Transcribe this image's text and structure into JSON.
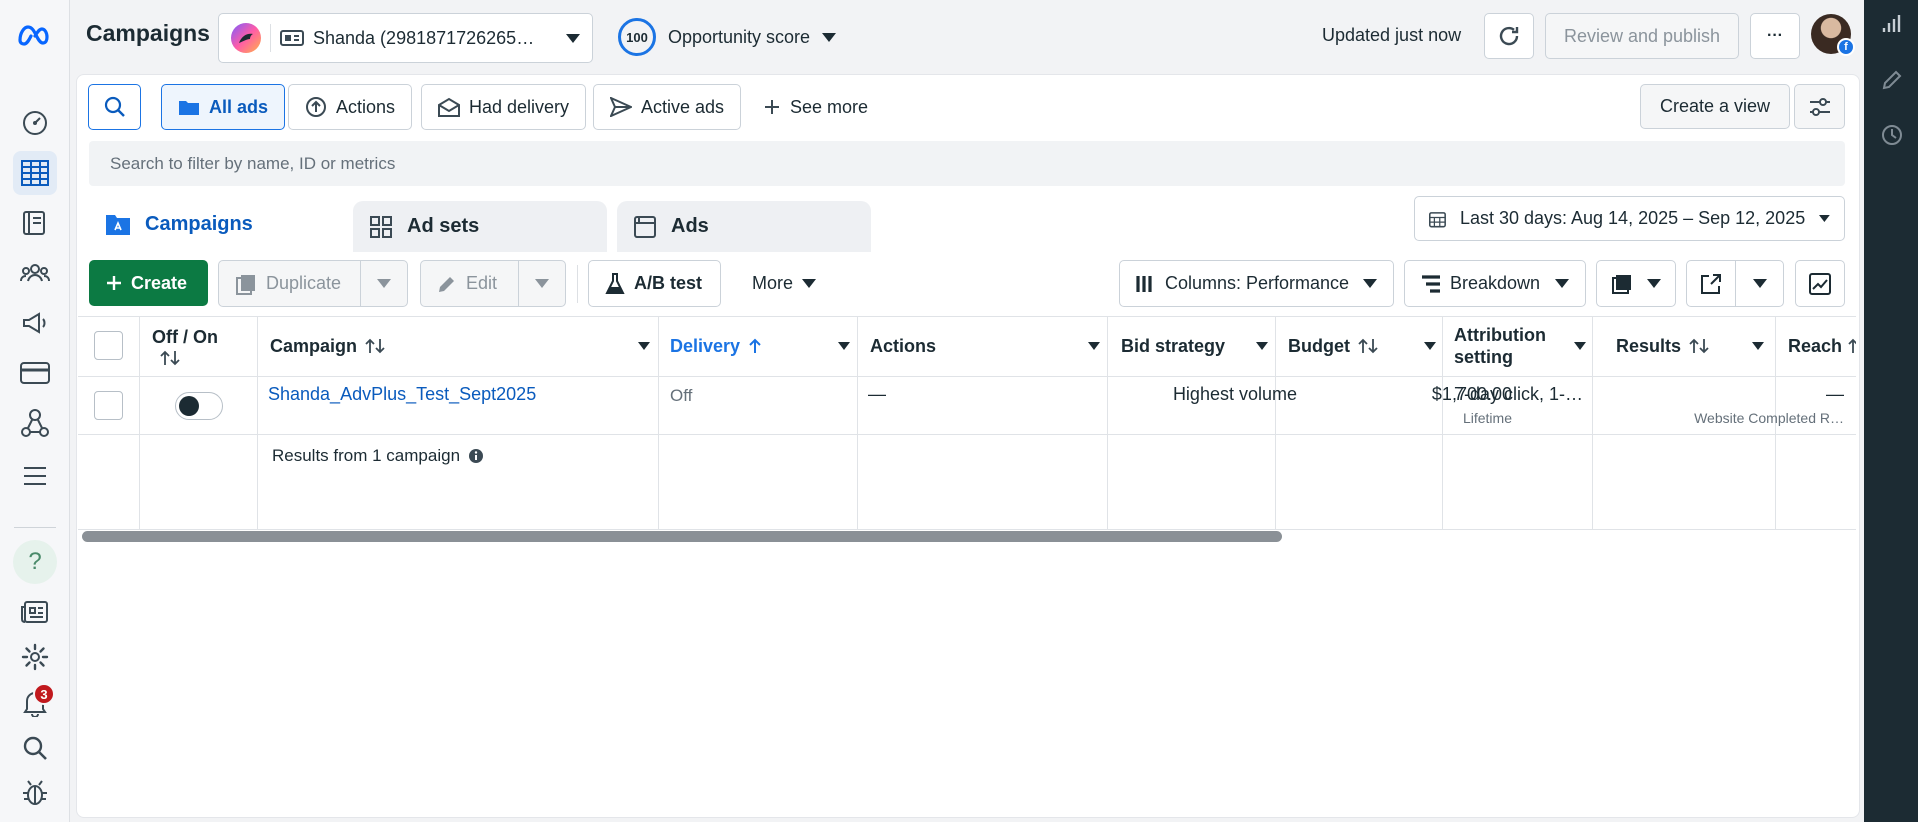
{
  "header": {
    "title": "Campaigns",
    "account_name": "Shanda (2981871726265…",
    "opportunity_score": "100",
    "opportunity_label": "Opportunity score",
    "updated": "Updated just now",
    "review_publish": "Review and publish",
    "more": "···"
  },
  "filters": {
    "all_ads": "All ads",
    "actions": "Actions",
    "had_delivery": "Had delivery",
    "active_ads": "Active ads",
    "see_more": "See more",
    "create_view": "Create a view",
    "search_placeholder": "Search to filter by name, ID or metrics"
  },
  "tabs": {
    "campaigns": "Campaigns",
    "ad_sets": "Ad sets",
    "ads": "Ads"
  },
  "date_range": "Last 30 days: Aug 14, 2025 – Sep 12, 2025",
  "toolbar": {
    "create": "Create",
    "duplicate": "Duplicate",
    "edit": "Edit",
    "ab_test": "A/B test",
    "more": "More",
    "columns": "Columns: Performance",
    "breakdown": "Breakdown"
  },
  "table": {
    "headers": {
      "off_on": "Off / On",
      "campaign": "Campaign",
      "delivery": "Delivery",
      "actions": "Actions",
      "bid_strategy": "Bid strategy",
      "budget": "Budget",
      "attribution_1": "Attribution",
      "attribution_2": "setting",
      "results": "Results",
      "reach": "Reach"
    },
    "row": {
      "campaign": "Shanda_AdvPlus_Test_Sept2025",
      "delivery": "Off",
      "actions": "—",
      "bid_strategy": "Highest volume",
      "budget": "$1,700.00",
      "budget_sub": "Lifetime",
      "attribution": "7-day click, 1-…",
      "results": "—",
      "results_sub": "Website Completed R…"
    },
    "summary": "Results from 1 campaign"
  },
  "notifications_count": "3",
  "help": "?",
  "colors": {
    "accent": "#1b74e4",
    "create_green": "#0c7a43",
    "badge_red": "#c1191e",
    "right_rail": "#1c2b33"
  }
}
